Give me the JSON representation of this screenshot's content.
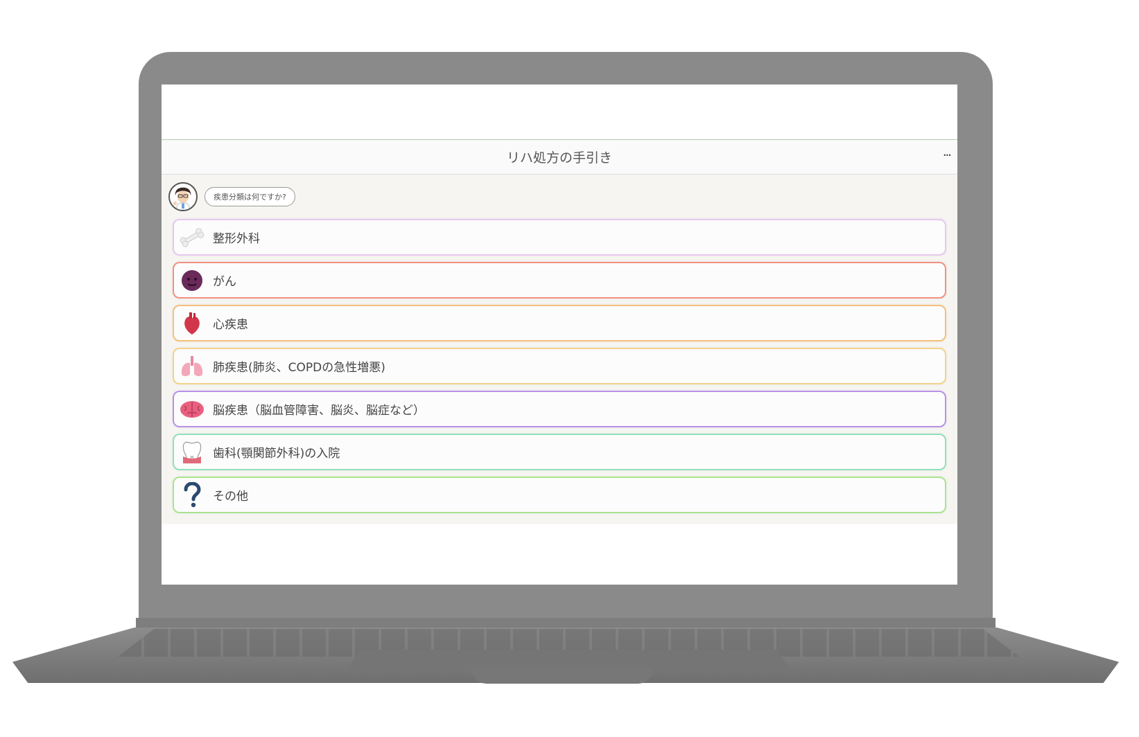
{
  "app": {
    "title": "リハ処方の手引き",
    "more_label": "···"
  },
  "chat": {
    "bot_message": "疾患分類は何ですか?"
  },
  "options": [
    {
      "label": "整形外科",
      "icon": "bone-icon",
      "border_color": "#e7c8ef"
    },
    {
      "label": "がん",
      "icon": "cancer-cell-icon",
      "border_color": "#f29080"
    },
    {
      "label": "心疾患",
      "icon": "heart-icon",
      "border_color": "#f5bf7a"
    },
    {
      "label": "肺疾患(肺炎、COPDの急性増悪)",
      "icon": "lungs-icon",
      "border_color": "#f2d28a"
    },
    {
      "label": "脳疾患（脳血管障害、脳炎、脳症など）",
      "icon": "brain-icon",
      "border_color": "#b990e8"
    },
    {
      "label": "歯科(顎関節外科)の入院",
      "icon": "tooth-icon",
      "border_color": "#8fe0ba"
    },
    {
      "label": "その他",
      "icon": "question-icon",
      "border_color": "#a8e490"
    }
  ]
}
